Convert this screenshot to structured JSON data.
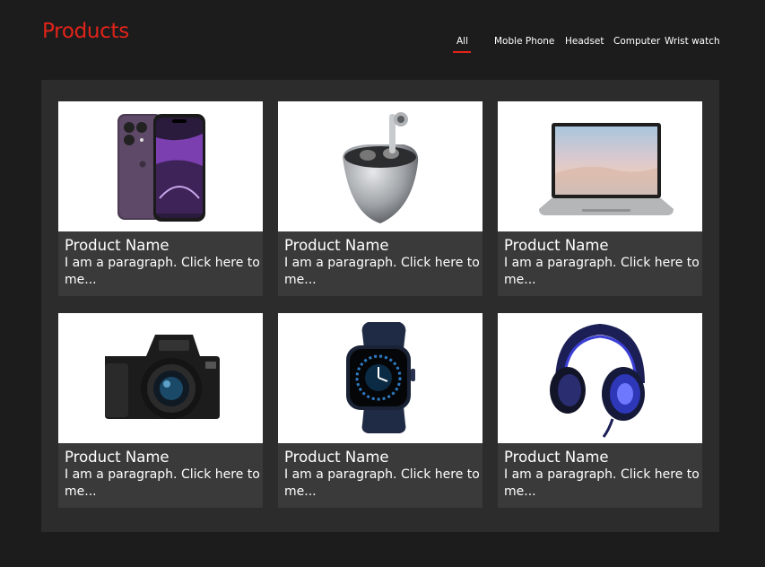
{
  "header": {
    "title": "Products"
  },
  "nav": {
    "tabs": [
      {
        "label": "All",
        "active": true
      },
      {
        "label": "Moble Phone",
        "active": false
      },
      {
        "label": "Headset",
        "active": false
      },
      {
        "label": "Computer",
        "active": false
      },
      {
        "label": "Wrist watch",
        "active": false
      }
    ]
  },
  "colors": {
    "accent": "#e2231a",
    "background": "#1c1c1c",
    "panel": "#2c2c2c",
    "card": "#3a3a3a"
  },
  "products": [
    {
      "name": "Product Name",
      "description": "I am a paragraph. Click here to me...",
      "image": "mobile-phone-image"
    },
    {
      "name": "Product Name",
      "description": "I am a paragraph. Click here to me...",
      "image": "earbuds-image"
    },
    {
      "name": "Product Name",
      "description": "I am a paragraph. Click here to me...",
      "image": "laptop-image"
    },
    {
      "name": "Product Name",
      "description": "I am a paragraph. Click here to me...",
      "image": "camera-image"
    },
    {
      "name": "Product Name",
      "description": "I am a paragraph. Click here to me...",
      "image": "smartwatch-image"
    },
    {
      "name": "Product Name",
      "description": "I am a paragraph. Click here to me...",
      "image": "gaming-headset-image"
    }
  ]
}
